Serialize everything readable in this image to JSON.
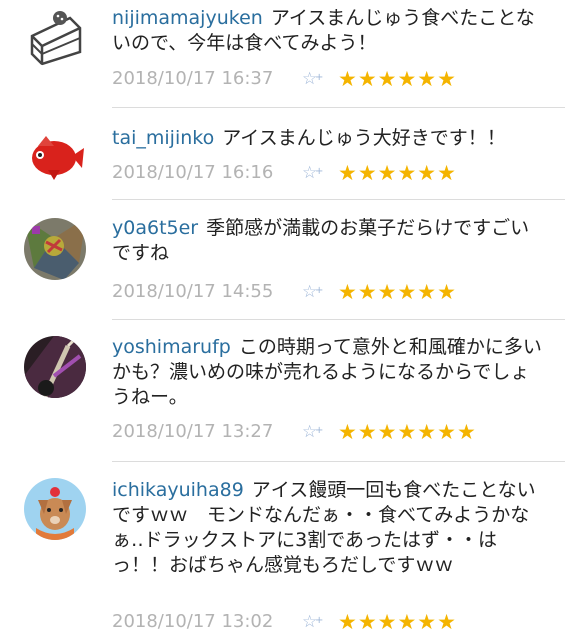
{
  "colors": {
    "username": "#2a6e9e",
    "timestamp": "#b3b3b3",
    "star": "#f4b400",
    "add_star": "#9fb7d8"
  },
  "comments": [
    {
      "username": "nijimamajyuken",
      "text": "アイスまんじゅう食べたことないので、今年は食べてみよう！",
      "timestamp": "2018/10/17 16:37",
      "add_star_icon": "☆+",
      "star_count": 6,
      "stars": "★★★★★★",
      "avatar_icon": "cake-icon"
    },
    {
      "username": "tai_mijinko",
      "text": "アイスまんじゅう大好きです！！",
      "timestamp": "2018/10/17 16:16",
      "add_star_icon": "☆+",
      "star_count": 6,
      "stars": "★★★★★★",
      "avatar_icon": "red-fish-icon"
    },
    {
      "username": "y0a6t5er",
      "text": "季節感が満載のお菓子だらけですごいですね",
      "timestamp": "2018/10/17 14:55",
      "add_star_icon": "☆+",
      "star_count": 6,
      "stars": "★★★★★★",
      "avatar_icon": "abstract-photo-icon"
    },
    {
      "username": "yoshimarufp",
      "text": "この時期って意外と和風確かに多いかも？濃いめの味が売れるようになるからでしょうねー。",
      "timestamp": "2018/10/17 13:27",
      "add_star_icon": "☆+",
      "star_count": 7,
      "stars": "★★★★★★★",
      "avatar_icon": "guitar-photo-icon"
    },
    {
      "username": "ichikayuiha89",
      "text": "アイス饅頭一回も食べたことないですｗｗ　モンドなんだぁ・・食べてみようかなぁ‥ドラックストアに3割であったはず・・はっ！！おばちゃん感覚もろだしですｗｗ",
      "timestamp": "2018/10/17 13:02",
      "add_star_icon": "☆+",
      "star_count": 6,
      "stars": "★★★★★★",
      "avatar_icon": "dog-character-icon"
    }
  ]
}
